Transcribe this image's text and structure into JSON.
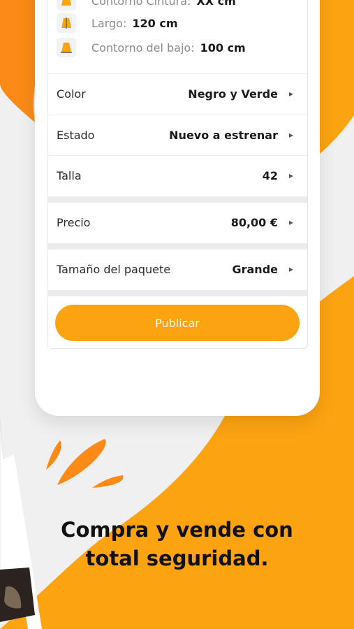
{
  "colors": {
    "background": "#f0f0f1",
    "accent_orange": "#fca311",
    "deep_orange": "#fb8a17",
    "text_dark": "#1a1a1a",
    "text_muted": "#8a8a8e"
  },
  "measurements": [
    {
      "label": "Contorno Cintura:",
      "value": "XX cm",
      "icon": "skirt-waist-icon"
    },
    {
      "label": "Largo:",
      "value": "120 cm",
      "icon": "skirt-length-icon"
    },
    {
      "label": "Contorno del bajo:",
      "value": "100 cm",
      "icon": "skirt-hem-icon"
    }
  ],
  "attributes": [
    {
      "label": "Color",
      "value": "Negro y Verde"
    },
    {
      "label": "Estado",
      "value": "Nuevo a estrenar"
    },
    {
      "label": "Talla",
      "value": "42"
    },
    {
      "label": "Precio",
      "value": "80,00 €"
    },
    {
      "label": "Tamaño del paquete",
      "value": "Grande"
    }
  ],
  "publish_button": {
    "label": "Publicar"
  },
  "headline": {
    "line1": "Compra y vende con",
    "line2": "total seguridad."
  }
}
